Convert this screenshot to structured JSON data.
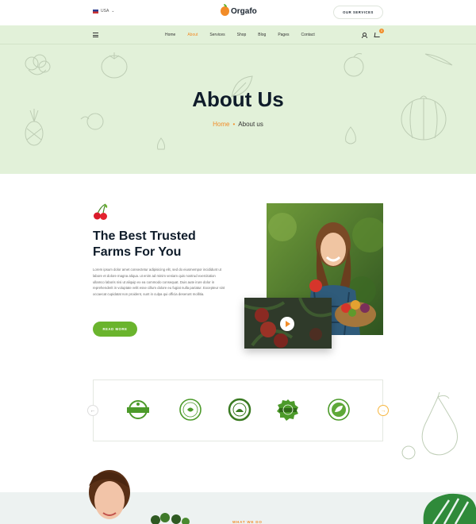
{
  "topbar": {
    "language": "USA",
    "logo_text": "Orgafo",
    "services_button": "OUR SERVICES"
  },
  "nav": {
    "items": [
      {
        "label": "Home"
      },
      {
        "label": "About"
      },
      {
        "label": "Services"
      },
      {
        "label": "Shop"
      },
      {
        "label": "Blog"
      },
      {
        "label": "Pages"
      },
      {
        "label": "Contact"
      }
    ],
    "active": "About",
    "cart_count": "0"
  },
  "hero": {
    "title": "About Us",
    "breadcrumb_home": "Home",
    "breadcrumb_separator": "•",
    "breadcrumb_current": "About us"
  },
  "about": {
    "title_line1": "The Best Trusted",
    "title_line2": "Farms For You",
    "paragraph": "Lorem ipsum dolor amet consectetur adipisicing elit, sed do eiusmempor incididunt ut labore et dolore magna aliqua. ut enim ad minim veniam quis nostrud exercitation ullamco laboris nisi ut aliquip ex ea commodo consequat. Duis aute irure dolor in reprehenderit in voluptate velit esse cillum dolore eu fugiat nulla pariatur. Excepteur sint occaecat cupidatat non proident, sunt in culpa qui officia deserunt mollitia.",
    "read_more": "READ MORE"
  },
  "partners": {
    "prev": "←",
    "next": "→"
  },
  "bottom": {
    "eyebrow": "WHAT WE DO"
  },
  "colors": {
    "accent_orange": "#f28c28",
    "accent_green": "#6ab42d",
    "hero_bg": "#e2f1d9"
  }
}
